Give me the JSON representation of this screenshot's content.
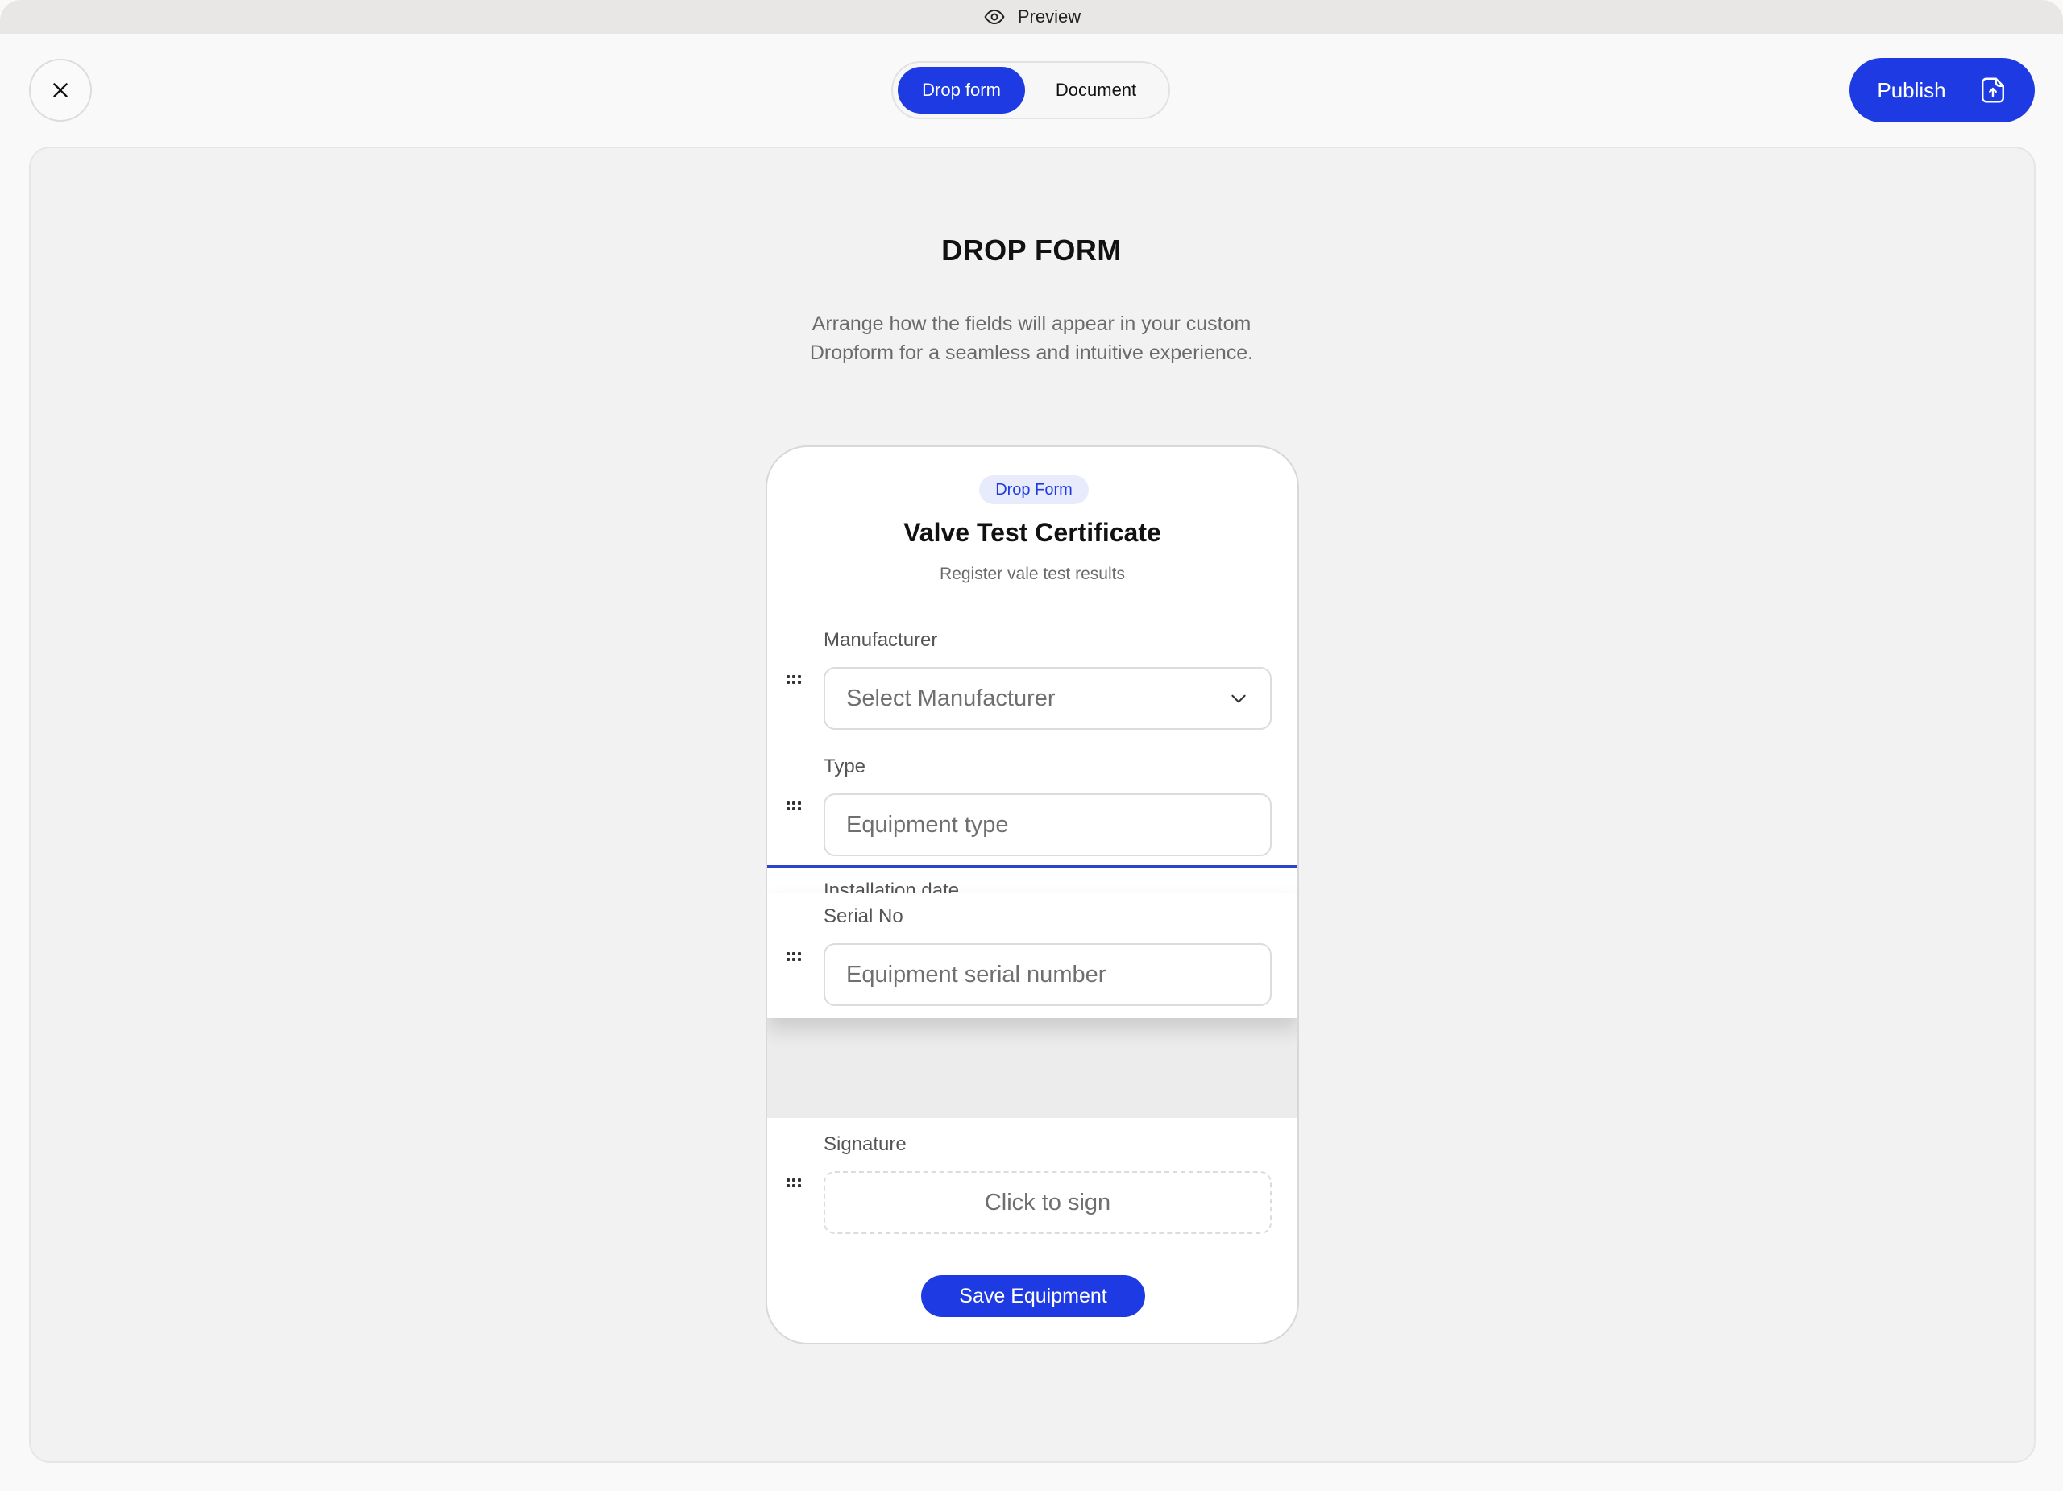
{
  "window": {
    "title": "Preview",
    "title_icon": "eye-icon"
  },
  "toolbar": {
    "close_icon": "close-icon",
    "tabs": [
      {
        "label": "Drop form",
        "active": true
      },
      {
        "label": "Document",
        "active": false
      }
    ],
    "publish_label": "Publish",
    "publish_icon": "file-upload-icon"
  },
  "page": {
    "heading": "DROP FORM",
    "description_line1": "Arrange how the fields will appear in your custom",
    "description_line2": "Dropform for a seamless and intuitive experience."
  },
  "form": {
    "badge": "Drop Form",
    "title": "Valve Test Certificate",
    "subtitle": "Register vale test results",
    "fields": {
      "manufacturer": {
        "label": "Manufacturer",
        "placeholder": "Select Manufacturer"
      },
      "type": {
        "label": "Type",
        "placeholder": "Equipment type"
      },
      "installation_date": {
        "label": "Installation date"
      },
      "serial_no": {
        "label": "Serial No",
        "placeholder": "Equipment serial number"
      },
      "signature": {
        "label": "Signature",
        "placeholder": "Click to sign"
      }
    },
    "submit_label": "Save Equipment"
  },
  "colors": {
    "accent": "#1d3ae3",
    "badge_bg": "#e8ebfb",
    "canvas_bg": "#f2f2f2",
    "drop_indicator": "#2f44cc"
  }
}
